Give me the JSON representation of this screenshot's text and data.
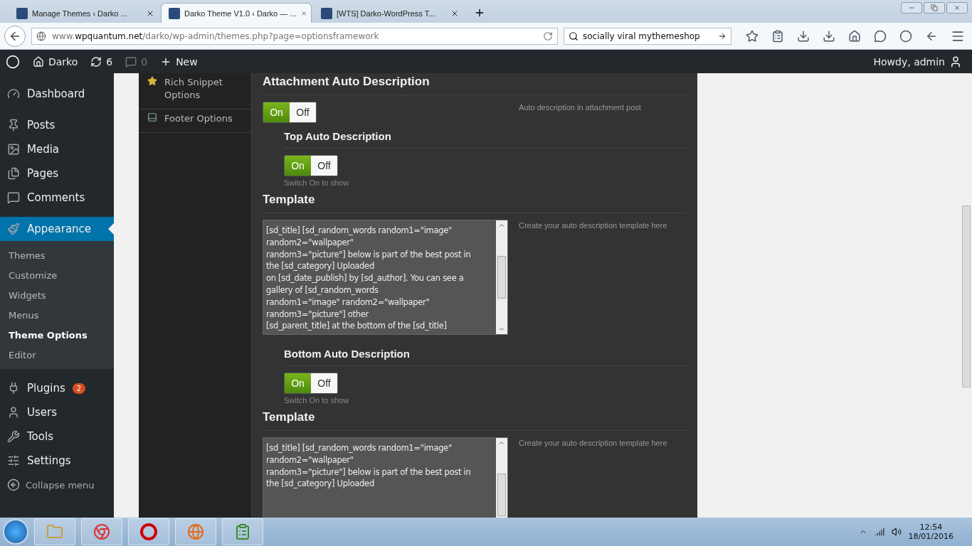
{
  "browser": {
    "tabs": [
      {
        "title": "Manage Themes ‹ Darko ...",
        "selected": false
      },
      {
        "title": "Darko Theme V1.0 ‹ Darko — ...",
        "selected": true
      },
      {
        "title": "[WTS] Darko-WordPress T...",
        "selected": false
      }
    ],
    "url": "www.**wpquantum.net**/darko/wp-admin/themes.php?page=optionsframework",
    "search": {
      "value": "socially viral mythemeshop"
    }
  },
  "admin_bar": {
    "site": "Darko",
    "updates": "6",
    "comments": "0",
    "new": "New",
    "greeting": "Howdy, admin"
  },
  "sidebar": {
    "items": [
      {
        "label": "Dashboard",
        "selected": false
      },
      {
        "label": "Posts",
        "selected": false
      },
      {
        "label": "Media",
        "selected": false
      },
      {
        "label": "Pages",
        "selected": false
      },
      {
        "label": "Comments",
        "selected": false
      },
      {
        "label": "Appearance",
        "selected": true,
        "children": [
          {
            "label": "Themes",
            "selected": false
          },
          {
            "label": "Customize",
            "selected": false
          },
          {
            "label": "Widgets",
            "selected": false
          },
          {
            "label": "Menus",
            "selected": false
          },
          {
            "label": "Theme Options",
            "selected": true
          },
          {
            "label": "Editor",
            "selected": false
          }
        ]
      },
      {
        "label": "Plugins",
        "selected": false,
        "badge": "2"
      },
      {
        "label": "Users",
        "selected": false
      },
      {
        "label": "Tools",
        "selected": false
      },
      {
        "label": "Settings",
        "selected": false
      }
    ],
    "collapse": "Collapse menu"
  },
  "options_nav": [
    {
      "label": "Rich Snippet Options"
    },
    {
      "label": "Footer Options"
    }
  ],
  "sections": [
    {
      "kind": "switch",
      "title": "Attachment Auto Description",
      "on_label": "On",
      "off_label": "Off",
      "on": true,
      "description": "Auto description in attachment post"
    },
    {
      "kind": "sub_switch",
      "title": "Top Auto Description",
      "on_label": "On",
      "off_label": "Off",
      "on": true,
      "hint": "Switch On to show"
    },
    {
      "kind": "template",
      "title": "Template",
      "value": "[sd_title] [sd_random_words random1=\"image\"\nrandom2=\"wallpaper\"\nrandom3=\"picture\"] below is part of the best post in\nthe [sd_category] Uploaded\non [sd_date_publish] by [sd_author]. You can see a\ngallery of [sd_random_words\nrandom1=\"image\" random2=\"wallpaper\"\nrandom3=\"picture\"] other\n[sd_parent_title] at the bottom of the [sd_title]",
      "description": "Create your auto description template here"
    },
    {
      "kind": "sub_switch",
      "title": "Bottom Auto Description",
      "on_label": "On",
      "off_label": "Off",
      "on": true,
      "hint": "Switch On to show"
    },
    {
      "kind": "template",
      "title": "Template",
      "value": "[sd_title] [sd_random_words random1=\"image\"\nrandom2=\"wallpaper\"\nrandom3=\"picture\"] below is part of the best post in\nthe [sd_category] Uploaded",
      "description": "Create your auto description template here"
    }
  ],
  "taskbar": {
    "time": "12:54",
    "date": "18/01/2016"
  }
}
